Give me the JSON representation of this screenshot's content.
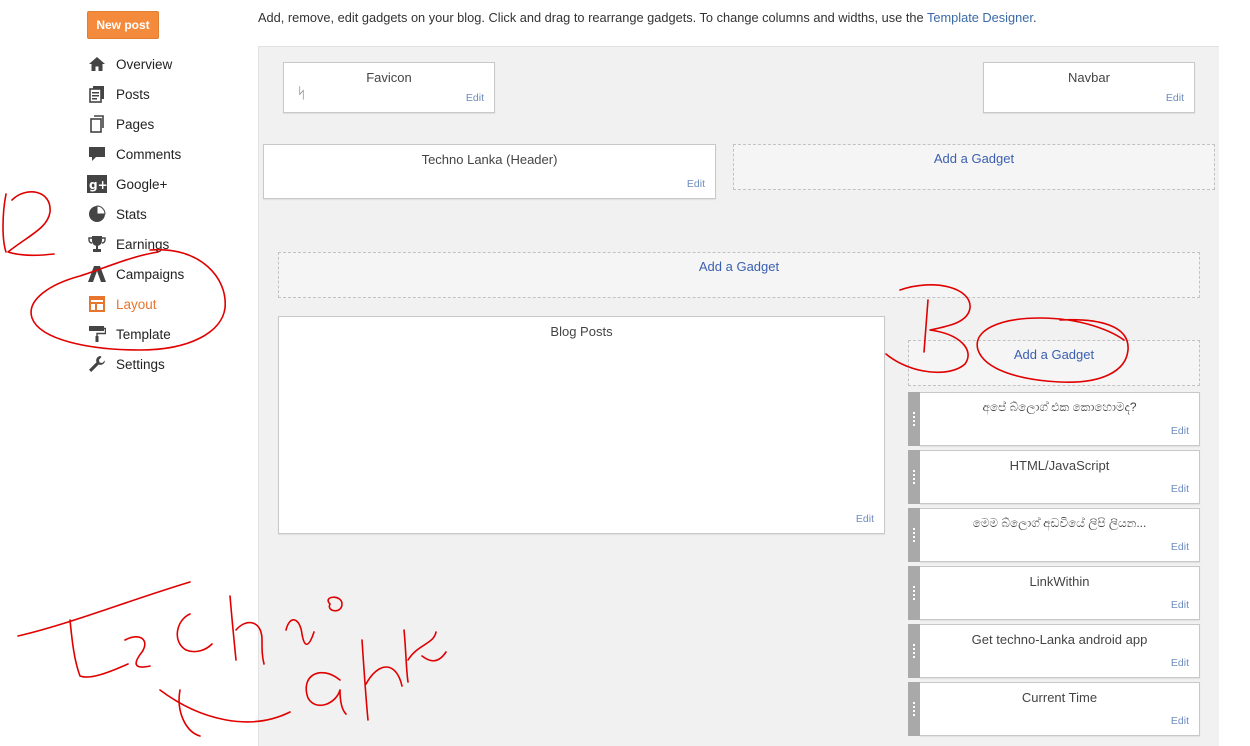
{
  "sidebar": {
    "new_post": "New post",
    "items": [
      {
        "label": "Overview",
        "icon": "home-icon"
      },
      {
        "label": "Posts",
        "icon": "posts-icon"
      },
      {
        "label": "Pages",
        "icon": "pages-icon"
      },
      {
        "label": "Comments",
        "icon": "comment-icon"
      },
      {
        "label": "Google+",
        "icon": "google-plus-icon"
      },
      {
        "label": "Stats",
        "icon": "pie-chart-icon"
      },
      {
        "label": "Earnings",
        "icon": "trophy-icon"
      },
      {
        "label": "Campaigns",
        "icon": "campaigns-icon"
      },
      {
        "label": "Layout",
        "icon": "layout-icon",
        "active": true
      },
      {
        "label": "Template",
        "icon": "paint-roller-icon"
      },
      {
        "label": "Settings",
        "icon": "wrench-icon"
      }
    ]
  },
  "intro": {
    "text": "Add, remove, edit gadgets on your blog. Click and drag to rearrange gadgets. To change columns and widths, use the ",
    "link": "Template Designer",
    "end": "."
  },
  "layout": {
    "favicon": {
      "title": "Favicon",
      "edit": "Edit",
      "glyph": "ᛋ"
    },
    "navbar": {
      "title": "Navbar",
      "edit": "Edit"
    },
    "header": {
      "title": "Techno Lanka (Header)",
      "edit": "Edit"
    },
    "add_gadget": "Add a Gadget",
    "blog_posts": {
      "title": "Blog Posts",
      "edit": "Edit"
    },
    "sidebar_gadgets": [
      {
        "title": "අපේ බ්ලොග් එක කොහොමද?",
        "edit": "Edit"
      },
      {
        "title": "HTML/JavaScript",
        "edit": "Edit"
      },
      {
        "title": "මෙම බ්ලොග් අඩවියේ ලිපි ලියන...",
        "edit": "Edit"
      },
      {
        "title": "LinkWithin",
        "edit": "Edit"
      },
      {
        "title": "Get techno-Lanka android app",
        "edit": "Edit"
      },
      {
        "title": "Current Time",
        "edit": "Edit"
      }
    ]
  },
  "colors": {
    "accent": "#f48a3c",
    "active": "#e8752e",
    "link": "#3b5fb0",
    "annotation": "#e00000"
  }
}
